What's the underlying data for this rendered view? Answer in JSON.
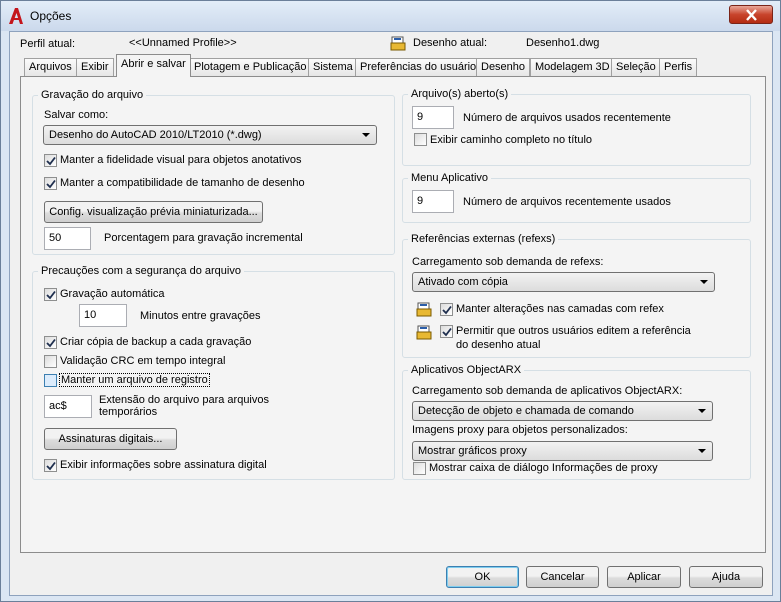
{
  "window": {
    "title": "Opções"
  },
  "profile": {
    "label": "Perfil atual:",
    "value": "<<Unnamed Profile>>",
    "drawing_label": "Desenho atual:",
    "drawing_value": "Desenho1.dwg"
  },
  "tabs": [
    "Arquivos",
    "Exibir",
    "Abrir e salvar",
    "Plotagem e Publicação",
    "Sistema",
    "Preferências do usuário",
    "Desenho",
    "Modelagem 3D",
    "Seleção",
    "Perfis"
  ],
  "save": {
    "group_title": "Gravação do arquivo",
    "save_as_label": "Salvar como:",
    "save_as_value": "Desenho do AutoCAD 2010/LT2010 (*.dwg)",
    "visual_fidelity": "Manter a fidelidade visual para objetos anotativos",
    "size_compat": "Manter a compatibilidade de tamanho de desenho",
    "thumbnail_button": "Config. visualização prévia miniaturizada...",
    "incremental_value": "50",
    "incremental_label": "Porcentagem para gravação incremental"
  },
  "safety": {
    "group_title": "Precauções com a segurança do arquivo",
    "autosave": "Gravação automática",
    "minutes_value": "10",
    "minutes_label": "Minutos entre gravações",
    "backup": "Criar cópia de backup a cada gravação",
    "crc": "Validação CRC em tempo integral",
    "log": "Manter um arquivo de registro",
    "ext_value": "ac$",
    "ext_label_1": "Extensão do arquivo para arquivos",
    "ext_label_2": "temporários",
    "sig_button": "Assinaturas digitais...",
    "sig_info": "Exibir informações sobre assinatura digital"
  },
  "open_files": {
    "group_title": "Arquivo(s) aberto(s)",
    "recent_value": "9",
    "recent_label": "Número de arquivos usados recentemente",
    "fullpath": "Exibir caminho completo no título"
  },
  "app_menu": {
    "group_title": "Menu Aplicativo",
    "recent_value": "9",
    "recent_label": "Número de arquivos recentemente usados"
  },
  "xrefs": {
    "group_title": "Referências externas (refexs)",
    "demand_label": "Carregamento sob demanda de refexs:",
    "demand_value": "Ativado com cópia",
    "keep_layers": "Manter alterações nas camadas com refex",
    "allow_edit_1": "Permitir que outros usuários editem a referência",
    "allow_edit_2": "do desenho atual"
  },
  "arx": {
    "group_title": "Aplicativos ObjectARX",
    "demand_label": "Carregamento sob demanda de aplicativos ObjectARX:",
    "demand_value": "Detecção de objeto e chamada de comando",
    "proxy_label": "Imagens proxy para objetos personalizados:",
    "proxy_value": "Mostrar gráficos proxy",
    "proxy_dialog": "Mostrar caixa de diálogo Informações de proxy"
  },
  "buttons": {
    "ok": "OK",
    "cancel": "Cancelar",
    "apply": "Aplicar",
    "help": "Ajuda"
  },
  "checks": {
    "visual_fidelity": true,
    "size_compat": true,
    "autosave": true,
    "backup": true,
    "crc": false,
    "log": false,
    "sig_info": true,
    "fullpath": false,
    "keep_layers": true,
    "allow_edit": true,
    "proxy_dialog": false
  },
  "colors": {
    "accent": "#3c7fb1",
    "close": "#c8442c",
    "logo": "#c4151c"
  }
}
